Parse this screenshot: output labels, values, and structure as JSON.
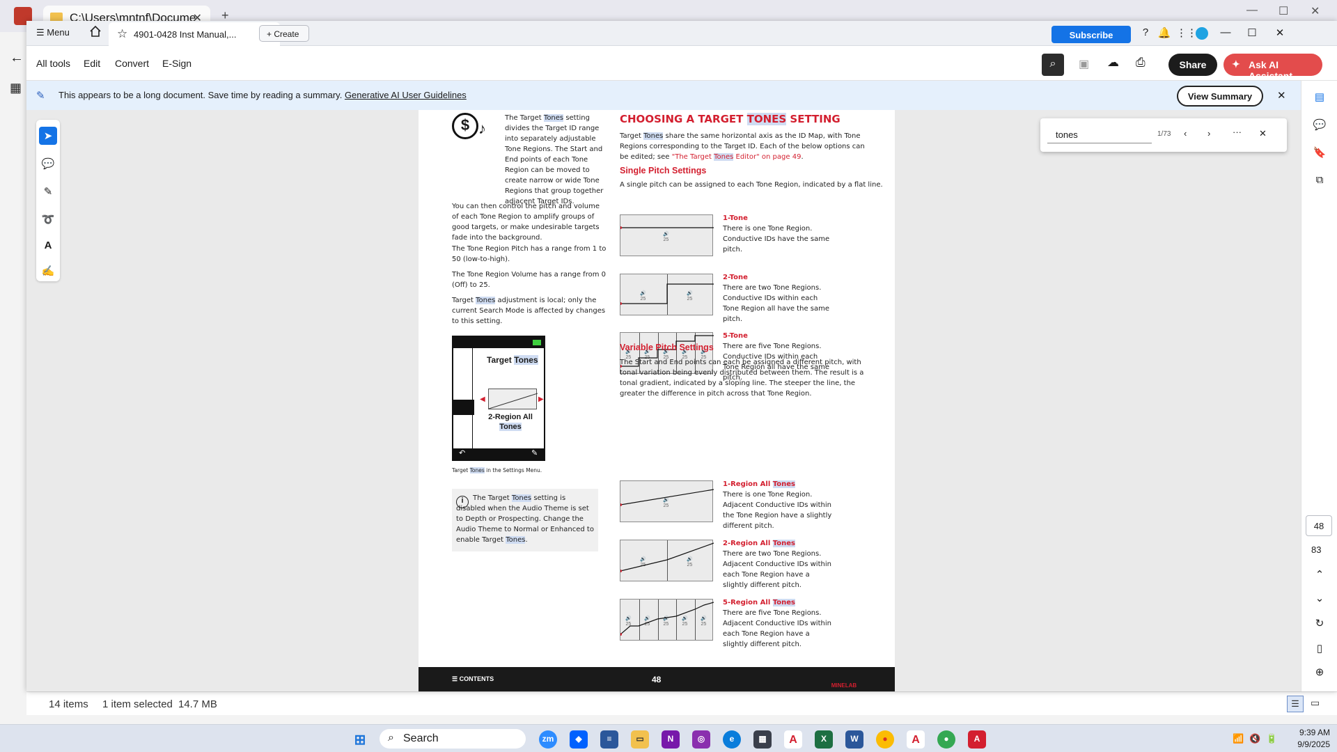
{
  "explorer": {
    "tab_title": "C:\\Users\\mntnf\\Docume",
    "status_items": "14 items",
    "status_selected": "1 item selected",
    "status_size": "14.7 MB"
  },
  "acrobat": {
    "menu_label": "Menu",
    "doc_tab": "4901-0428 Inst Manual,...",
    "create_label": "Create",
    "subscribe_label": "Subscribe",
    "tools": [
      "All tools",
      "Edit",
      "Convert",
      "E-Sign"
    ],
    "share_label": "Share",
    "ask_ai_label": "Ask AI Assistant",
    "banner_text": "This appears to be a long document. Save time by reading a summary.",
    "banner_link": "Generative AI User Guidelines",
    "view_summary_label": "View Summary",
    "find": {
      "query": "tones",
      "count": "1/73"
    },
    "page_number": "48",
    "page_total": "83"
  },
  "page": {
    "left": {
      "p1a": "The Target ",
      "p1b": "Tones",
      "p1c": " setting divides the Target ID range into separately adjustable Tone Regions. The Start and End points of each Tone Region can be moved to create narrow or wide Tone Regions that group together adjacent Target IDs.",
      "p2": "You can then control the pitch and volume of each Tone Region to amplify groups of good targets, or make undesirable targets fade into the background.",
      "p3": "The Tone Region Pitch has a range from 1 to 50 (low-to-high).",
      "p4": "The Tone Region Volume has a range from 0 (Off) to 25.",
      "p5a": "Target ",
      "p5b": "Tones",
      "p5c": " adjustment is local; only the current Search Mode is affected by changes to this setting.",
      "screen_title_a": "Target ",
      "screen_title_b": "Tones",
      "screen_label_a": "2-Region All",
      "screen_label_b": "Tones",
      "caption_a": "Target ",
      "caption_b": "Tones",
      "caption_c": " in the Settings Menu.",
      "note_a": "The Target ",
      "note_b": "Tones",
      "note_c": " setting is disabled when the Audio Theme is set to Depth or Prospecting. Change the Audio Theme to Normal or Enhanced to enable Target ",
      "note_d": "Tones",
      "note_e": "."
    },
    "right": {
      "heading_a": "CHOOSING A TARGET ",
      "heading_b": "TONES",
      "heading_c": " SETTING",
      "intro_a": "Target ",
      "intro_b": "Tones",
      "intro_c": " share the same horizontal axis as the ID Map, with Tone Regions corresponding to the Target ID. Each of the below options can be edited; see ",
      "intro_d": "\"The Target ",
      "intro_e": "Tones",
      "intro_f": " Editor\" on page 49",
      "single_heading": "Single Pitch Settings",
      "single_intro": "A single pitch can be assigned to each Tone Region, indicated by a flat line.",
      "single": [
        {
          "title": "1-Tone",
          "desc": "There is one Tone Region. Conductive IDs have the same pitch."
        },
        {
          "title": "2-Tone",
          "desc": "There are two Tone Regions. Conductive IDs within each Tone Region all have the same pitch."
        },
        {
          "title": "5-Tone",
          "desc": "There are five Tone Regions. Conductive IDs within each Tone Region all have the same pitch."
        }
      ],
      "variable_heading": "Variable Pitch Settings",
      "variable_intro": "The Start and End points can each be assigned a different pitch, with tonal variation being evenly distributed between them. The result is a tonal gradient, indicated by a sloping line. The steeper the line, the greater the difference in pitch across that Tone Region.",
      "variable": [
        {
          "title": "1-Region All ",
          "title_hl": "Tones",
          "desc": "There is one Tone Region. Adjacent Conductive IDs within the Tone Region have a slightly different pitch."
        },
        {
          "title": "2-Region All ",
          "title_hl": "Tones",
          "desc": "There are two Tone Regions. Adjacent Conductive IDs within each Tone Region have a slightly different pitch."
        },
        {
          "title": "5-Region All ",
          "title_hl": "Tones",
          "desc": "There are five Tone Regions. Adjacent Conductive IDs within each Tone Region have a slightly different pitch."
        }
      ],
      "vol": "25"
    },
    "footer": {
      "contents": "CONTENTS",
      "page": "48",
      "logo": "MINELAB"
    }
  },
  "taskbar": {
    "search": "Search",
    "time": "9:39 AM",
    "date": "9/9/2025"
  }
}
